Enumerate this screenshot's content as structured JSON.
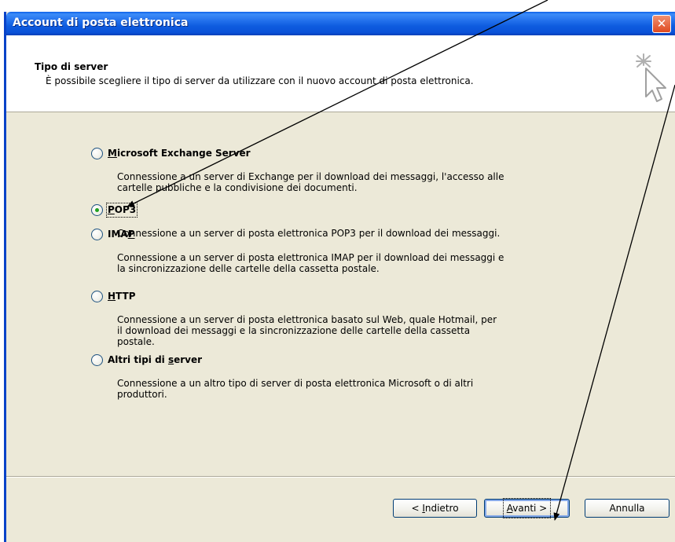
{
  "window": {
    "title": "Account di posta elettronica",
    "close_label": "✕"
  },
  "header": {
    "title": "Tipo di server",
    "subtitle": "È possibile scegliere il tipo di server da utilizzare con il nuovo account di posta elettronica.",
    "icon": "cursor-sparkle-icon"
  },
  "options": [
    {
      "label_pre": "",
      "label_key": "M",
      "label_post": "icrosoft Exchange Server",
      "desc_lines": [
        "Connessione a un server di Exchange per il download dei messaggi, l'accesso alle",
        "cartelle pubbliche e la condivisione dei documenti."
      ],
      "checked": false
    },
    {
      "label_pre": "",
      "label_key": "P",
      "label_post": "OP3",
      "desc_lines": [
        "Connessione a un server di posta elettronica POP3 per il download dei messaggi."
      ],
      "checked": true
    },
    {
      "label_pre": "IMA",
      "label_key": "P",
      "label_post": "",
      "desc_lines": [
        "Connessione a un server di posta elettronica IMAP per il download dei messaggi e",
        "la sincronizzazione delle cartelle della cassetta postale."
      ],
      "checked": false
    },
    {
      "label_pre": "",
      "label_key": "H",
      "label_post": "TTP",
      "desc_lines": [
        "Connessione a un server di posta elettronica basato sul Web, quale Hotmail, per",
        "il download dei messaggi e la sincronizzazione delle cartelle della cassetta",
        "postale."
      ],
      "checked": false
    },
    {
      "label_pre": "Altri tipi di ",
      "label_key": "s",
      "label_post": "erver",
      "desc_lines": [
        "Connessione a un altro tipo di server di posta elettronica Microsoft o di altri",
        "produttori."
      ],
      "checked": false
    }
  ],
  "buttons": {
    "back": {
      "pre": "< ",
      "key": "I",
      "post": "ndietro"
    },
    "next": {
      "pre": "",
      "key": "A",
      "post": "vanti >"
    },
    "cancel": {
      "pre": "Annulla",
      "key": "",
      "post": ""
    }
  },
  "colors": {
    "titlebar": "#0a5ee8",
    "dialog_bg": "#ece9d8",
    "radio_dot": "#21a121",
    "annotation_arrow": "#000000"
  }
}
